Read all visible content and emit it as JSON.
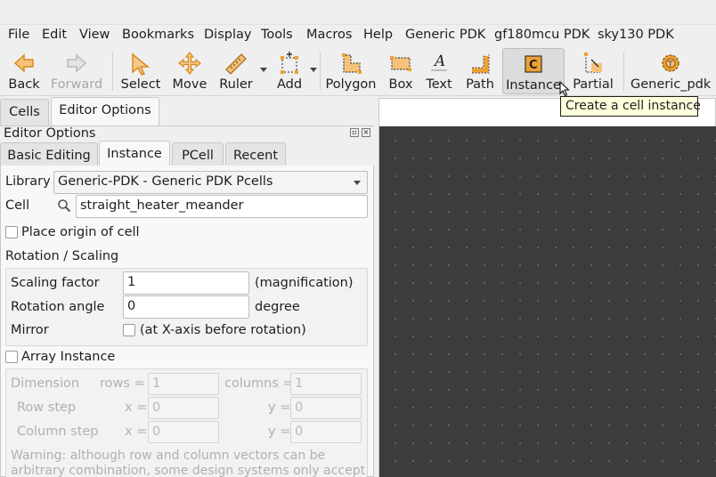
{
  "menubar": {
    "items": [
      "File",
      "Edit",
      "View",
      "Bookmarks",
      "Display",
      "Tools",
      "Macros",
      "Help",
      "Generic PDK",
      "gf180mcu PDK",
      "sky130 PDK"
    ]
  },
  "toolbar": {
    "back": "Back",
    "forward": "Forward",
    "select": "Select",
    "move": "Move",
    "ruler": "Ruler",
    "add": "Add",
    "polygon": "Polygon",
    "box": "Box",
    "text": "Text",
    "path": "Path",
    "instance": "Instance",
    "partial": "Partial",
    "generic_pdk": "Generic_pdk"
  },
  "tooltip": "Create a cell instance",
  "left_tabs": [
    "Cells",
    "Editor Options"
  ],
  "panel": {
    "title": "Editor Options",
    "tabs": [
      "Basic Editing",
      "Instance",
      "PCell",
      "Recent"
    ],
    "library_label": "Library",
    "library_value": "Generic-PDK - Generic PDK Pcells",
    "cell_label": "Cell",
    "cell_value": "straight_heater_meander",
    "place_origin_label": "Place origin of cell",
    "rotation_scaling_title": "Rotation / Scaling",
    "scaling_label": "Scaling factor",
    "scaling_value": "1",
    "scaling_unit": "(magnification)",
    "rotation_label": "Rotation angle",
    "rotation_value": "0",
    "rotation_unit": "degree",
    "mirror_label": "Mirror",
    "mirror_option": "(at X-axis before rotation)",
    "array_label": "Array Instance",
    "dimension_label": "Dimension",
    "rows_label": "rows =",
    "rows_value": "1",
    "columns_label": "columns =",
    "columns_value": "1",
    "row_step_label": "Row step",
    "column_step_label": "Column step",
    "x_label": "x =",
    "y_label": "y =",
    "row_step_x": "0",
    "row_step_y": "0",
    "column_step_x": "0",
    "column_step_y": "0",
    "warning_line1": "Warning: although row and column vectors can be",
    "warning_line2": "arbitrary combination, some design systems only accept"
  },
  "colors": {
    "accent_orange": "#f0a030",
    "canvas_bg": "#3c3c3c",
    "tooltip_bg": "#ffffdc"
  }
}
